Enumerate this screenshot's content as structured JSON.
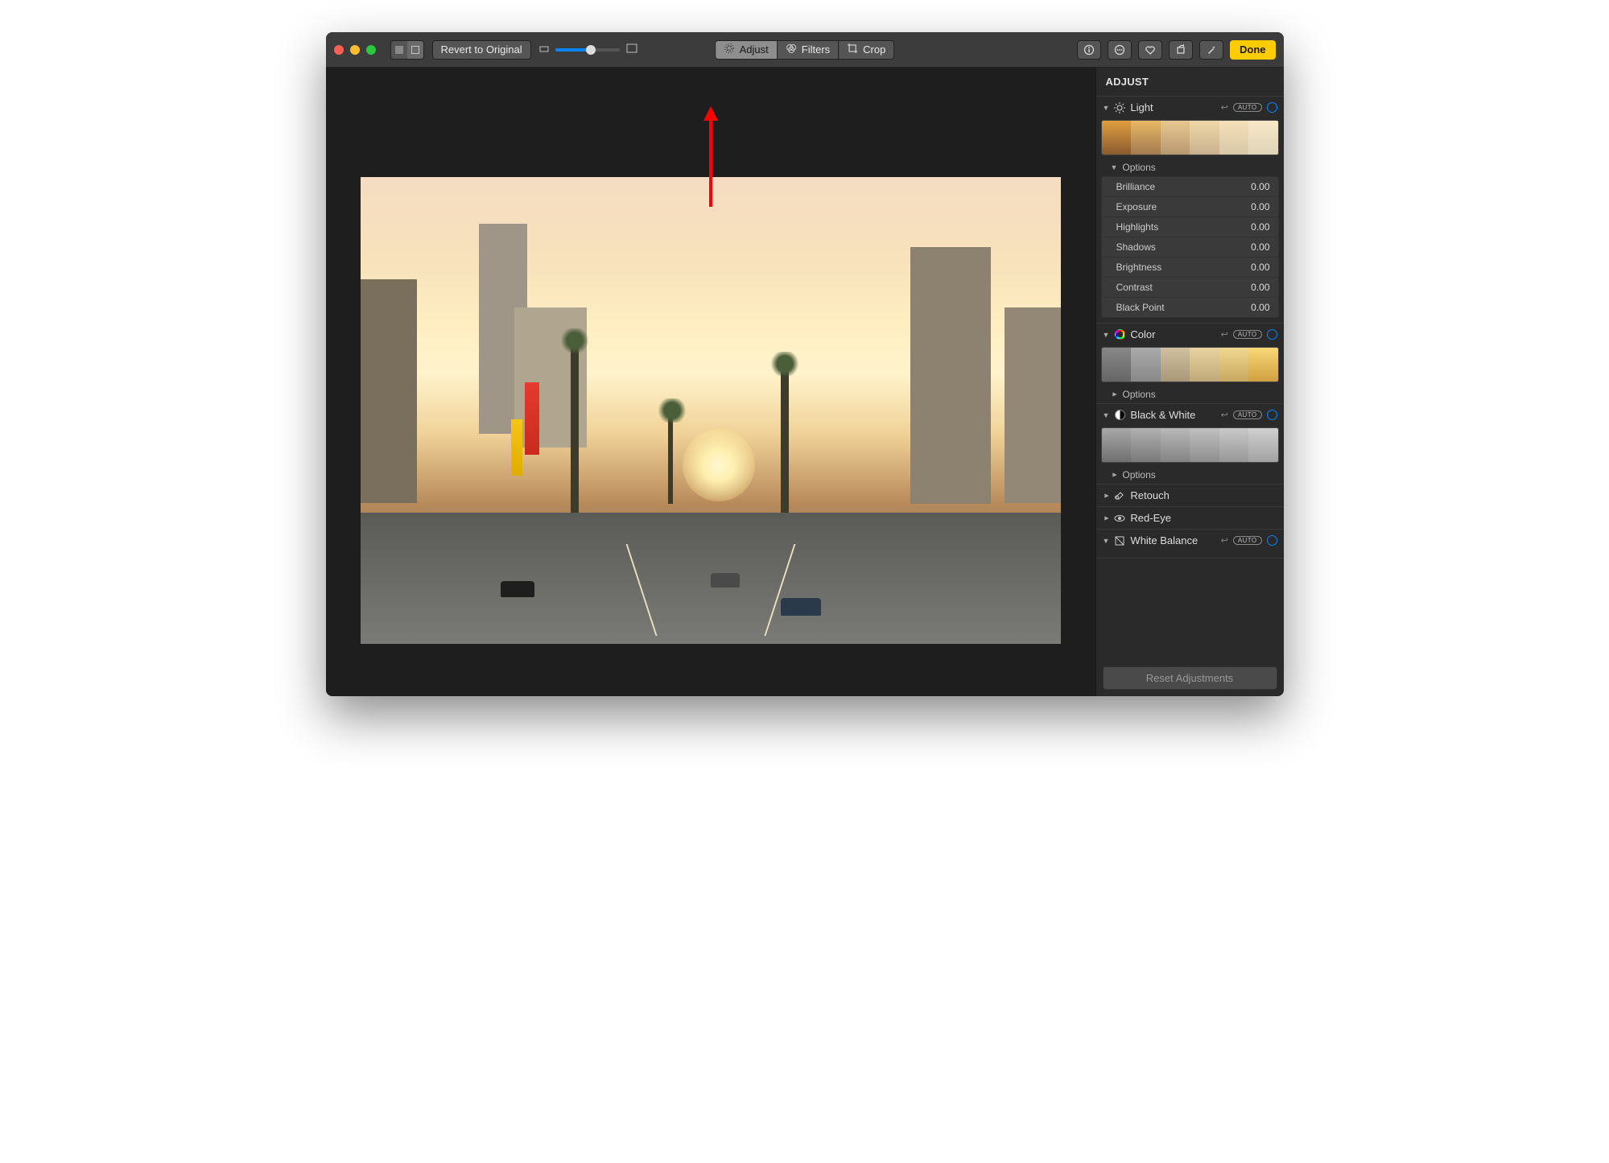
{
  "toolbar": {
    "revert_label": "Revert to Original",
    "tabs": {
      "adjust": "Adjust",
      "filters": "Filters",
      "crop": "Crop"
    },
    "done_label": "Done"
  },
  "sidebar": {
    "title": "ADJUST",
    "light": {
      "title": "Light",
      "auto": "AUTO",
      "options_label": "Options",
      "sliders": [
        {
          "label": "Brilliance",
          "value": "0.00"
        },
        {
          "label": "Exposure",
          "value": "0.00"
        },
        {
          "label": "Highlights",
          "value": "0.00"
        },
        {
          "label": "Shadows",
          "value": "0.00"
        },
        {
          "label": "Brightness",
          "value": "0.00"
        },
        {
          "label": "Contrast",
          "value": "0.00"
        },
        {
          "label": "Black Point",
          "value": "0.00"
        }
      ]
    },
    "color": {
      "title": "Color",
      "auto": "AUTO",
      "options_label": "Options"
    },
    "bw": {
      "title": "Black & White",
      "auto": "AUTO",
      "options_label": "Options"
    },
    "retouch": {
      "title": "Retouch"
    },
    "redeye": {
      "title": "Red-Eye"
    },
    "wb": {
      "title": "White Balance",
      "auto": "AUTO"
    },
    "reset_label": "Reset Adjustments"
  }
}
